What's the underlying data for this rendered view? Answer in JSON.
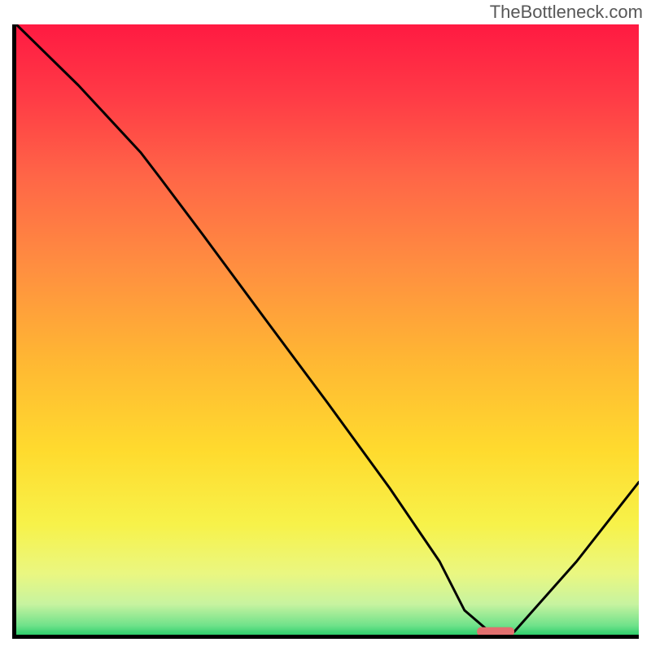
{
  "watermark": "TheBottleneck.com",
  "chart_data": {
    "type": "line",
    "title": "",
    "xlabel": "",
    "ylabel": "",
    "xlim": [
      0,
      100
    ],
    "ylim": [
      0,
      100
    ],
    "curve": {
      "name": "bottleneck-curve",
      "x": [
        0,
        10,
        20,
        23,
        30,
        40,
        50,
        60,
        68,
        72,
        76,
        80,
        90,
        100
      ],
      "y": [
        100,
        90,
        79,
        75,
        65.5,
        51.7,
        38,
        24,
        12,
        4,
        0.5,
        0.5,
        12,
        25
      ]
    },
    "marker": {
      "name": "optimal-range",
      "x_center": 77,
      "y": 0.5,
      "width": 6,
      "color": "#e2706f"
    },
    "gradient_stops": [
      {
        "offset": 0.0,
        "color": "#ff1a42"
      },
      {
        "offset": 0.12,
        "color": "#ff3b46"
      },
      {
        "offset": 0.25,
        "color": "#ff6647"
      },
      {
        "offset": 0.4,
        "color": "#ff8f40"
      },
      {
        "offset": 0.55,
        "color": "#ffb733"
      },
      {
        "offset": 0.7,
        "color": "#ffdb2e"
      },
      {
        "offset": 0.82,
        "color": "#f7f24a"
      },
      {
        "offset": 0.9,
        "color": "#eaf781"
      },
      {
        "offset": 0.95,
        "color": "#c7f3a0"
      },
      {
        "offset": 0.985,
        "color": "#6fe28a"
      },
      {
        "offset": 1.0,
        "color": "#2fcf6c"
      }
    ],
    "axis_color": "#000000",
    "axis_width": 5,
    "line_color": "#000000",
    "line_width": 3
  }
}
